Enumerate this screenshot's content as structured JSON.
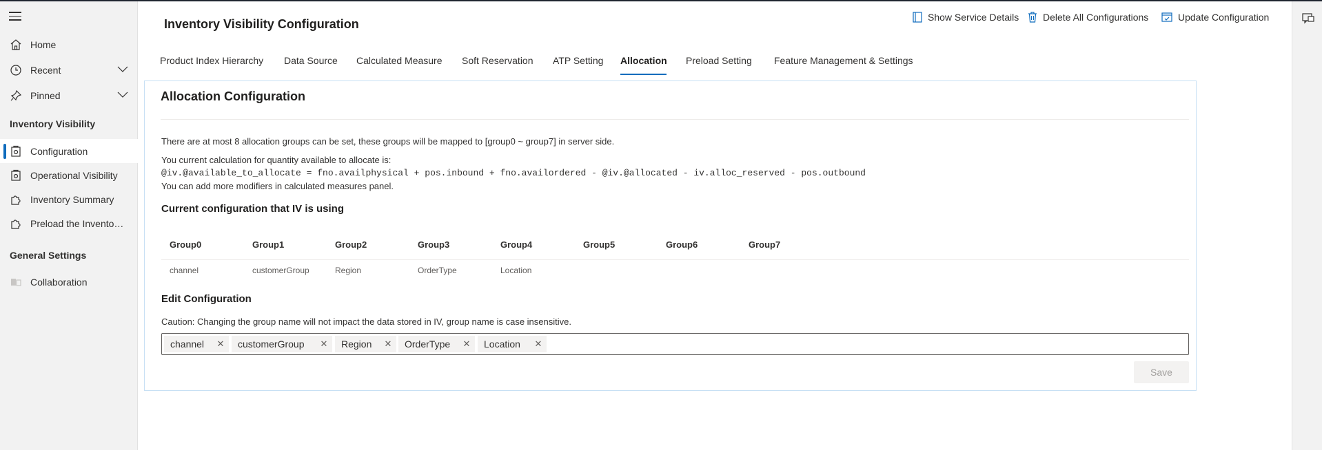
{
  "app": {
    "title": "Inventory Visibility Configuration"
  },
  "sidebar": {
    "items": [
      {
        "label": "Home",
        "icon": "home-icon"
      },
      {
        "label": "Recent",
        "icon": "clock-icon"
      },
      {
        "label": "Pinned",
        "icon": "pin-icon"
      }
    ],
    "section_inventory": "Inventory Visibility",
    "inventory_items": [
      {
        "label": "Configuration",
        "icon": "settings-doc-icon",
        "selected": true
      },
      {
        "label": "Operational Visibility",
        "icon": "settings-doc-icon"
      },
      {
        "label": "Inventory Summary",
        "icon": "puzzle-icon"
      },
      {
        "label": "Preload the Inventory Visibility Index Query",
        "icon": "puzzle-icon"
      }
    ],
    "section_general": "General Settings",
    "general_items": [
      {
        "label": "Collaboration",
        "icon": "collaboration-icon"
      }
    ]
  },
  "commands": {
    "show_service_details": "Show Service Details",
    "delete_all": "Delete All Configurations",
    "update": "Update Configuration"
  },
  "tabs": [
    {
      "label": "Product Index Hierarchy"
    },
    {
      "label": "Data Source"
    },
    {
      "label": "Calculated Measure"
    },
    {
      "label": "Soft Reservation"
    },
    {
      "label": "ATP Setting"
    },
    {
      "label": "Allocation",
      "active": true
    },
    {
      "label": "Preload Setting"
    },
    {
      "label": "Feature Management & Settings"
    }
  ],
  "panel": {
    "title": "Allocation Configuration",
    "intro": "There are at most 8 allocation groups can be set, these groups will be mapped to [group0 ~ group7] in server side.",
    "calc_label": "You current calculation for quantity available to allocate is:",
    "formula": "@iv.@available_to_allocate = fno.availphysical + pos.inbound + fno.availordered - @iv.@allocated - iv.alloc_reserved - pos.outbound",
    "modifiers_note": "You can add more modifiers in calculated measures panel.",
    "current_heading": "Current configuration that IV is using",
    "table": {
      "headers": [
        "Group0",
        "Group1",
        "Group2",
        "Group3",
        "Group4",
        "Group5",
        "Group6",
        "Group7"
      ],
      "values": [
        "channel",
        "customerGroup",
        "Region",
        "OrderType",
        "Location",
        "",
        "",
        ""
      ]
    },
    "edit_heading": "Edit Configuration",
    "caution": "Caution: Changing the group name will not impact the data stored in IV, group name is case insensitive.",
    "tags": [
      "channel",
      "customerGroup",
      "Region",
      "OrderType",
      "Location"
    ],
    "save_label": "Save"
  },
  "colors": {
    "accent": "#0f6cbd",
    "sidebar_bg": "#f2f2f2",
    "panel_border": "#c7e0f4"
  }
}
